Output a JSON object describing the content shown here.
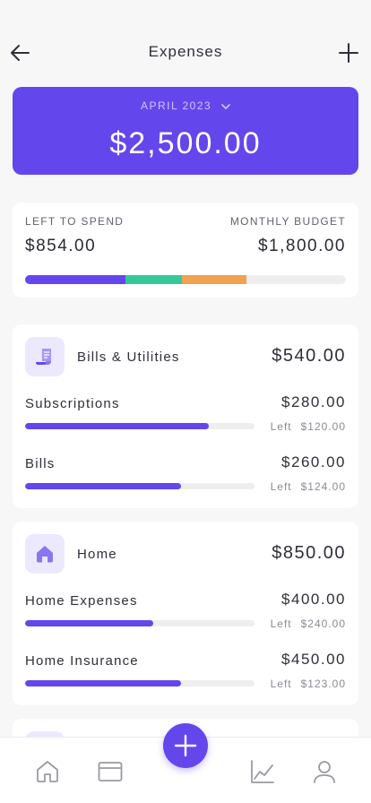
{
  "header": {
    "title": "Expenses"
  },
  "hero": {
    "month": "APRIL 2023",
    "amount": "$2,500.00"
  },
  "summary": {
    "left_label": "LEFT TO SPEND",
    "left_value": "$854.00",
    "budget_label": "MONTHLY BUDGET",
    "budget_value": "$1,800.00",
    "segments": [
      {
        "pct": 31.2,
        "color": "#6447ec"
      },
      {
        "pct": 17.6,
        "color": "#35c99a"
      },
      {
        "pct": 20.3,
        "color": "#f0a152"
      }
    ]
  },
  "categories": [
    {
      "name": "Bills & Utilities",
      "icon": "receipt-icon",
      "total": "$540.00",
      "items": [
        {
          "name": "Subscriptions",
          "amount": "$280.00",
          "left_word": "Left",
          "left": "$120.00",
          "progress": 0.8
        },
        {
          "name": "Bills",
          "amount": "$260.00",
          "left_word": "Left",
          "left": "$124.00",
          "progress": 0.68
        }
      ]
    },
    {
      "name": "Home",
      "icon": "house-icon",
      "total": "$850.00",
      "items": [
        {
          "name": "Home Expenses",
          "amount": "$400.00",
          "left_word": "Left",
          "left": "$240.00",
          "progress": 0.56
        },
        {
          "name": "Home Insurance",
          "amount": "$450.00",
          "left_word": "Left",
          "left": "$123.00",
          "progress": 0.68
        }
      ]
    }
  ],
  "tabbar": {
    "items": [
      "home-icon",
      "card-icon",
      "chart-icon",
      "profile-icon"
    ]
  },
  "colors": {
    "accent": "#6447ec",
    "accent_light": "#ece8fd"
  }
}
